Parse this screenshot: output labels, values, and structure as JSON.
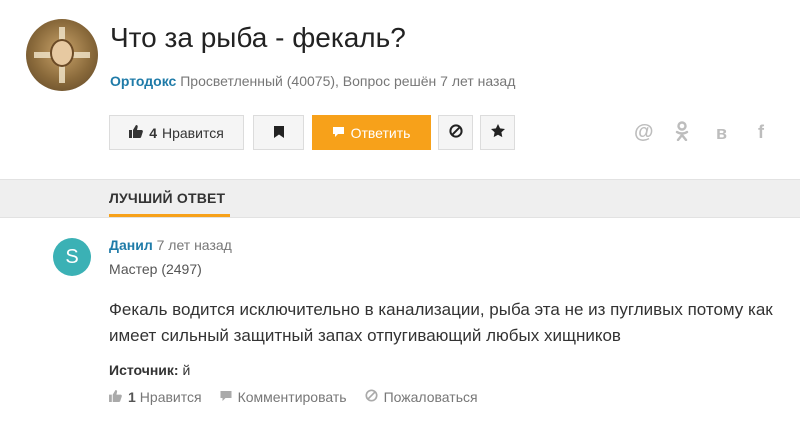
{
  "question": {
    "title": "Что за рыба - фекаль?",
    "author": "Ортодокс",
    "meta": "Просветленный (40075), Вопрос решён 7 лет назад"
  },
  "toolbar": {
    "like_count": "4",
    "like_label": "Нравится",
    "answer_label": "Ответить"
  },
  "share": {
    "at": "@",
    "ok": "ok",
    "vk": "в",
    "fb": "f"
  },
  "best_answer": {
    "tab_label": "ЛУЧШИЙ ОТВЕТ",
    "avatar_letter": "S",
    "author": "Данил",
    "time": "7 лет назад",
    "rank": "Мастер (2497)",
    "text": "Фекаль водится исключительно в канализации, рыба эта не из пугливых потому как имеет сильный защитный запах отпугивающий любых хищников",
    "source_label": "Источник:",
    "source_value": "й",
    "like_count": "1",
    "like_label": "Нравится",
    "comment_label": "Комментировать",
    "report_label": "Пожаловаться"
  },
  "colors": {
    "accent": "#f7a11a",
    "link": "#1f7ba8",
    "avatar_answer": "#3bb1b5"
  }
}
